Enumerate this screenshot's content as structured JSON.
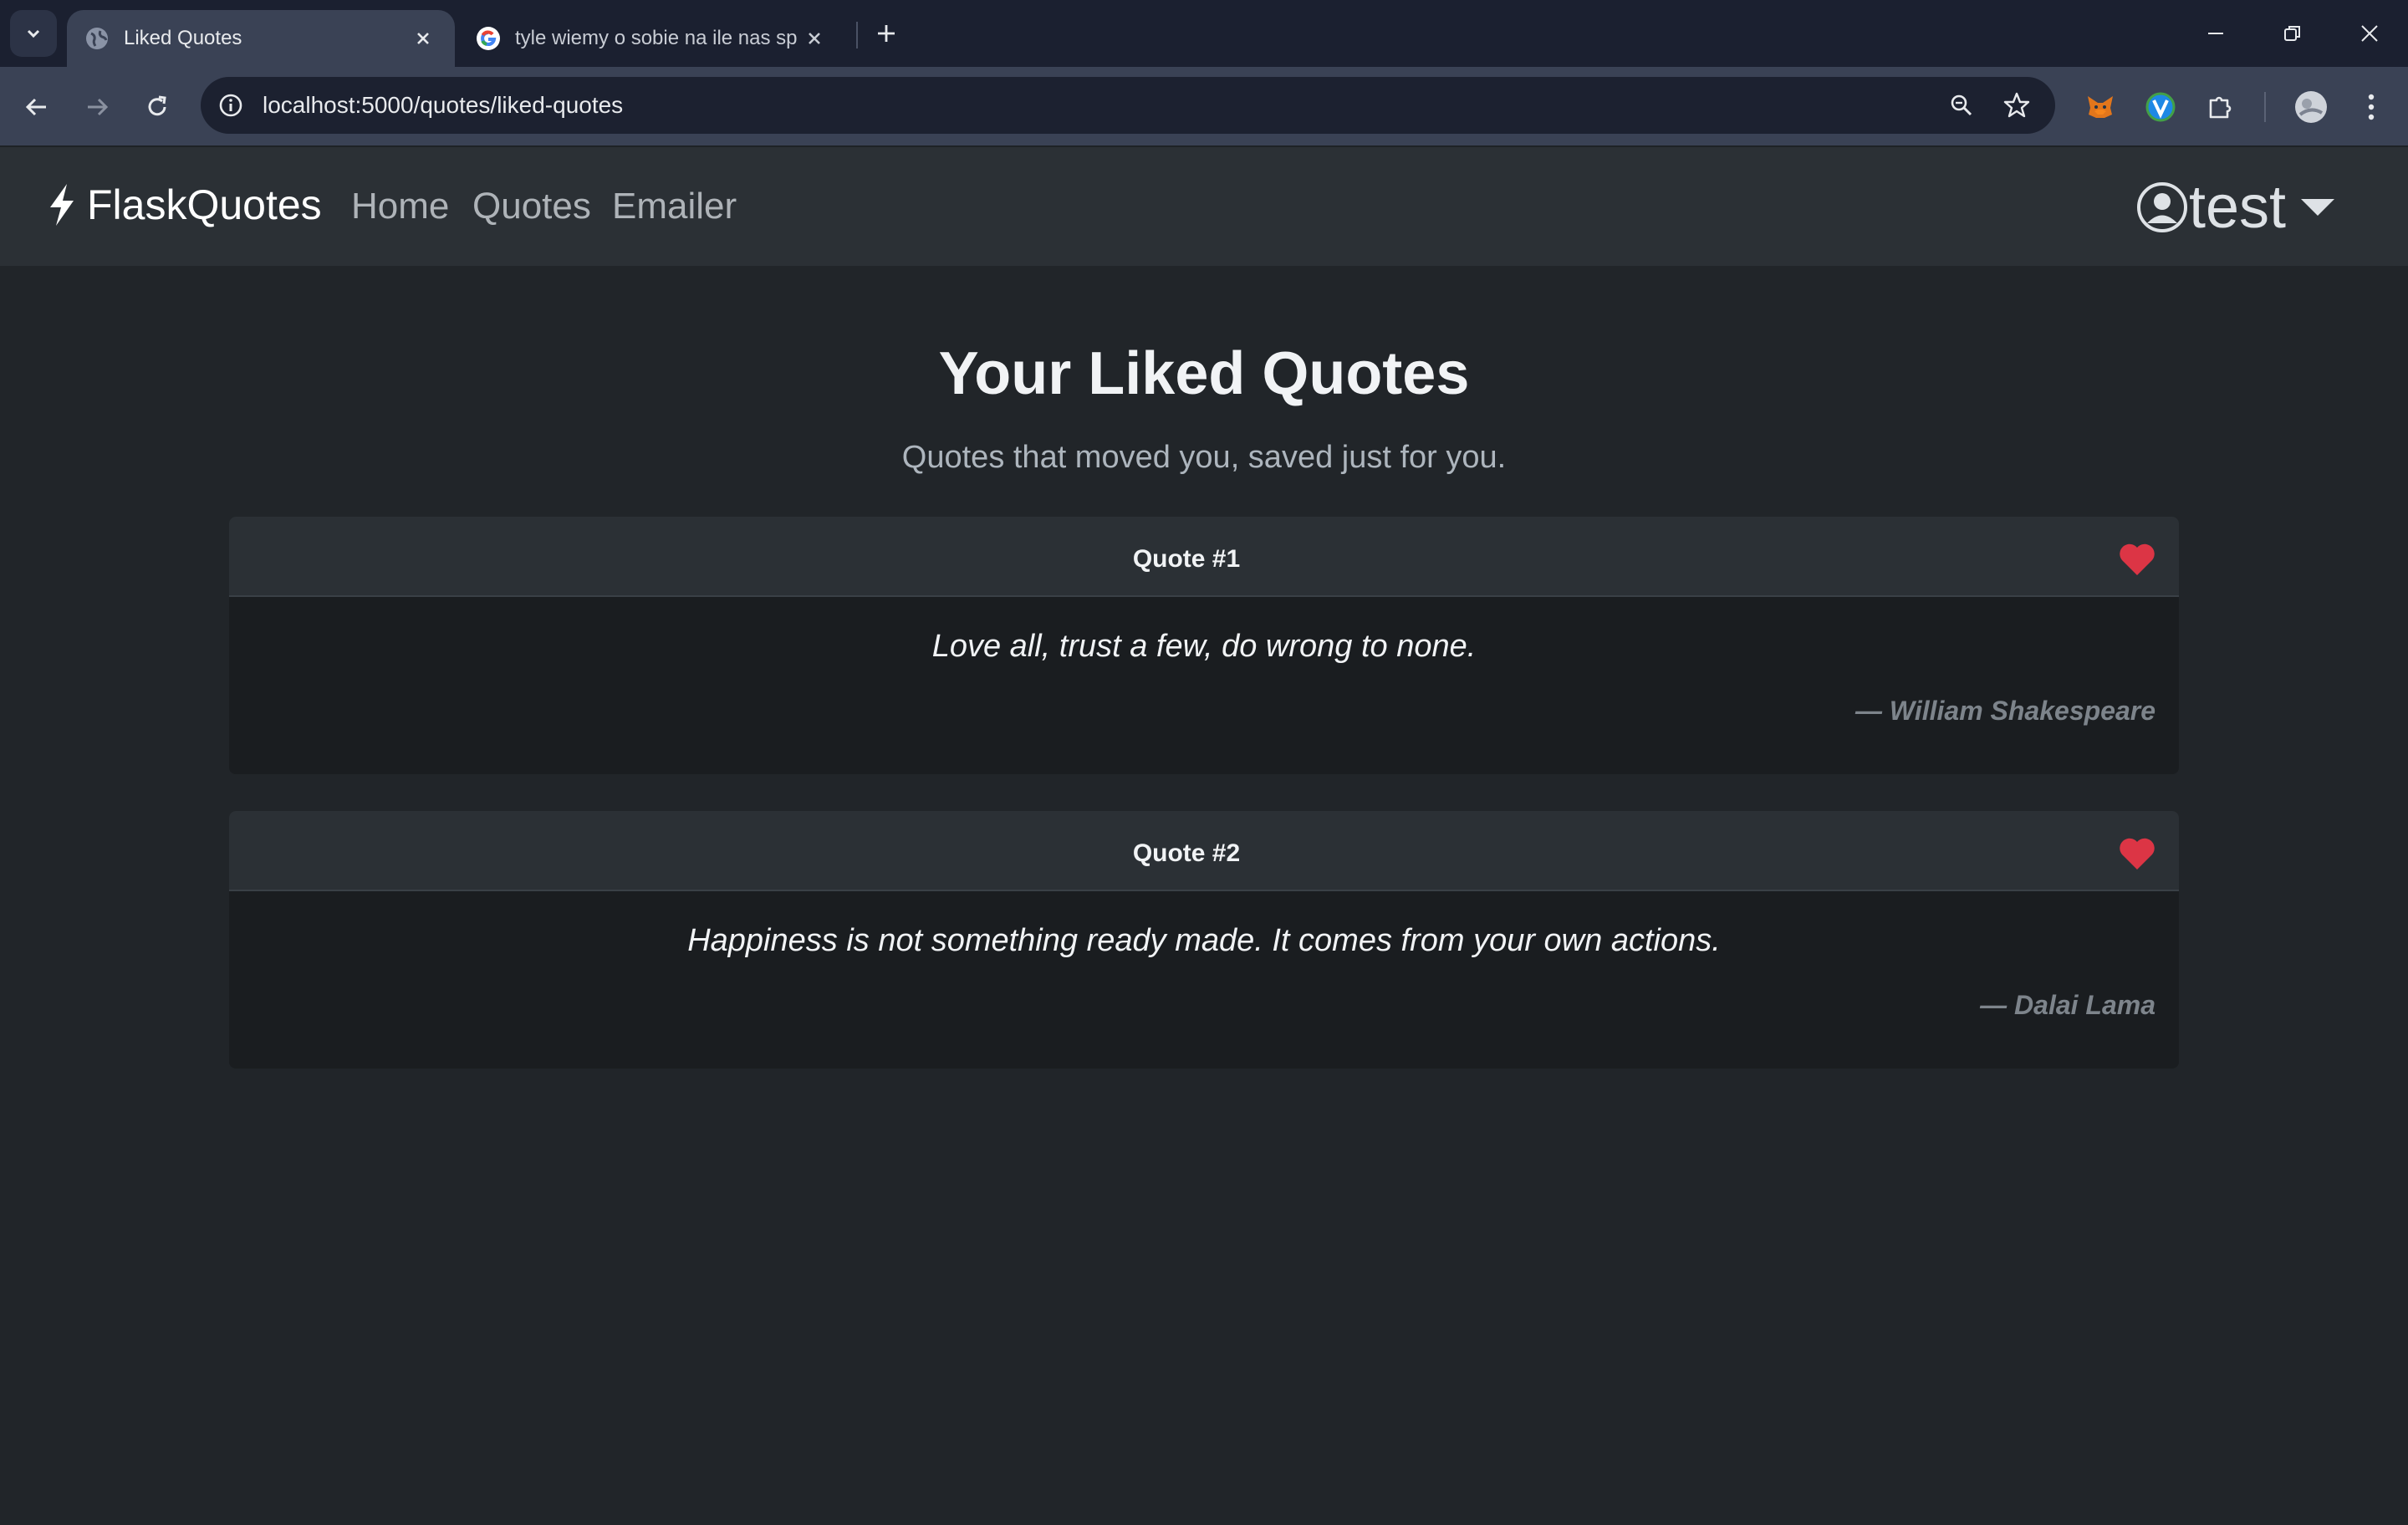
{
  "browser": {
    "tabs": [
      {
        "title": "Liked Quotes",
        "active": true,
        "favicon": "globe-icon"
      },
      {
        "title": "tyle wiemy o sobie na ile nas sp",
        "active": false,
        "favicon": "google-icon"
      }
    ],
    "url": "localhost:5000/quotes/liked-quotes"
  },
  "navbar": {
    "brand": "FlaskQuotes",
    "brand_icon": "lightning-icon",
    "links": [
      "Home",
      "Quotes",
      "Emailer"
    ],
    "user": "test"
  },
  "page": {
    "title": "Your Liked Quotes",
    "subtitle": "Quotes that moved you, saved just for you."
  },
  "quotes": [
    {
      "header": "Quote #1",
      "text": "Love all, trust a few, do wrong to none.",
      "author": "— William Shakespeare",
      "liked": true
    },
    {
      "header": "Quote #2",
      "text": "Happiness is not something ready made. It comes from your own actions.",
      "author": "— Dalai Lama",
      "liked": true
    }
  ],
  "colors": {
    "background": "#212529",
    "navbar": "#2b3035",
    "card_body": "#1a1d20",
    "heart": "#dc3545",
    "author": "#7d848b"
  }
}
